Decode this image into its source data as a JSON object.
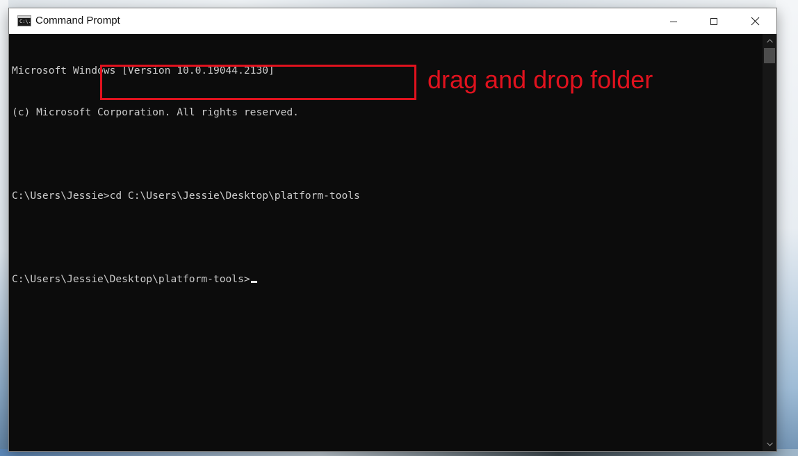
{
  "window": {
    "title": "Command Prompt",
    "icon": "cmd-icon",
    "icon_text": "C:\\."
  },
  "controls": {
    "minimize_icon": "minimize-icon",
    "maximize_icon": "maximize-icon",
    "close_icon": "close-icon"
  },
  "console": {
    "lines": [
      "Microsoft Windows [Version 10.0.19044.2130]",
      "(c) Microsoft Corporation. All rights reserved.",
      "",
      "C:\\Users\\Jessie>cd C:\\Users\\Jessie\\Desktop\\platform-tools",
      "",
      "C:\\Users\\Jessie\\Desktop\\platform-tools>"
    ]
  },
  "annotation": {
    "text": "drag and drop folder",
    "color": "#e0121e"
  },
  "colors": {
    "console_bg": "#0c0c0c",
    "console_text": "#cccccc",
    "titlebar_bg": "#ffffff"
  }
}
